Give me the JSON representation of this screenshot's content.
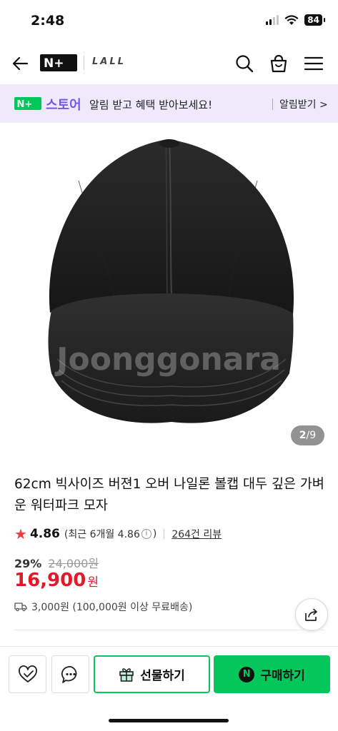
{
  "status": {
    "time": "2:48",
    "battery": "84"
  },
  "header": {
    "logo": "N+",
    "brand": "LALL"
  },
  "banner": {
    "logo": "N+",
    "store": "스토어",
    "message": "알림 받고 혜택 받아보세요!",
    "link": "알림받기 >"
  },
  "product": {
    "watermark": "Joonggonara",
    "image_counter": {
      "current": "2",
      "sep": "/",
      "total": "9"
    },
    "title": "62cm 빅사이즈 버젼1 오버 나일론 볼캡 대두 깊은 가벼운 워터파크 모자",
    "rating": {
      "star": "★",
      "score": "4.86",
      "recent_prefix": "(최근 6개월 4.86",
      "info": "i",
      "recent_suffix": ")",
      "reviews": "264건 리뷰"
    },
    "discount_pct": "29%",
    "original_price": "24,000원",
    "price": "16,900",
    "currency": "원",
    "shipping": "3,000원 (100,000원 이상 무료배송)"
  },
  "bottom": {
    "gift_label": "선물하기",
    "buy_label": "구매하기",
    "buy_badge": "N"
  },
  "colors": {
    "accent_green": "#03c75a",
    "price_red": "#e0192b",
    "store_purple": "#7355f0"
  }
}
